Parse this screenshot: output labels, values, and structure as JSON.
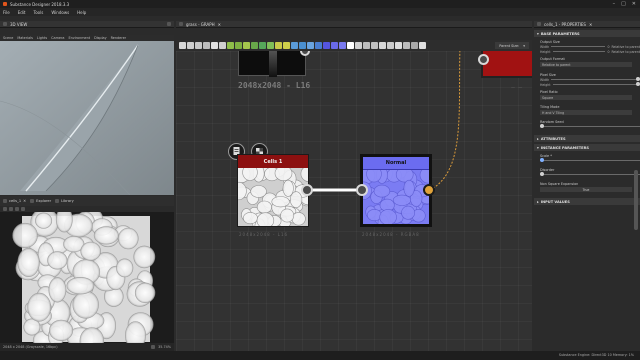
{
  "app": {
    "title": "Substance Designer 2018.3.3",
    "brand_color": "#e0551c"
  },
  "menu": [
    "File",
    "Edit",
    "Tools",
    "Windows",
    "Help"
  ],
  "view3d": {
    "tab": "3D VIEW",
    "menu": [
      "Scene",
      "Materials",
      "Lights",
      "Camera",
      "Environment",
      "Display",
      "Renderer"
    ]
  },
  "view2d": {
    "tabs": [
      {
        "label": "cells_1",
        "icon": "image-icon"
      },
      {
        "label": "Explorer",
        "icon": "folder-icon"
      },
      {
        "label": "Library",
        "icon": "library-icon"
      }
    ],
    "status_left": "2048 x 2048 (Grayscale, 16bpc)",
    "zoom": "35.74%"
  },
  "graph": {
    "tab": "grass - GRAPH",
    "parent_size_label": "Parent Size:",
    "top_node_label": "2048x2048 - L16",
    "cells_node": {
      "title": "Cells 1",
      "footer": "2048x2048 - L16"
    },
    "normal_node": {
      "title": "Normal",
      "footer": "2048x2048 - RGBA8"
    },
    "tool_colors": [
      "#d8d8d8",
      "#cfcfcf",
      "#c8c8c8",
      "#bdbdbd",
      "#e0e0e0",
      "#d0d0d0",
      "#8fbf4a",
      "#7fb042",
      "#a6c74d",
      "#68a84a",
      "#55a85a",
      "#7fbf58",
      "#c9c94a",
      "#cfcf4a",
      "#5a9bd8",
      "#4a8fd0",
      "#6aa4e0",
      "#4a7ed0",
      "#5555e0",
      "#6a6ae8",
      "#7a7af0",
      "#ffffff",
      "#d0d0d0",
      "#bdbdbd",
      "#c0c0c0",
      "#d8d8d8",
      "#cccccc",
      "#dddddd",
      "#bbbbbb",
      "#aaaaaa",
      "#e0e0e0"
    ]
  },
  "properties": {
    "tab": "cells_1 - PROPERTIES",
    "sections": {
      "base": "BASE PARAMETERS",
      "attributes": "ATTRIBUTES",
      "instance": "INSTANCE PARAMETERS",
      "inputs": "INPUT VALUES"
    },
    "output_size": {
      "label": "Output Size",
      "width": "Width",
      "height": "Height",
      "rel_w": "Relative to parent",
      "rel_h": "Relative to parent",
      "val_w": "0",
      "val_h": "0"
    },
    "output_format": {
      "label": "Output Format",
      "value": "Relative to parent"
    },
    "pixel_size": {
      "label": "Pixel Size",
      "width": "Width",
      "height": "Height"
    },
    "pixel_ratio": {
      "label": "Pixel Ratio",
      "value": "Square"
    },
    "tiling_mode": {
      "label": "Tiling Mode",
      "value": "H and V Tiling"
    },
    "random_seed": {
      "label": "Random Seed"
    },
    "scale": {
      "label": "Scale *"
    },
    "disorder": {
      "label": "Disorder"
    },
    "non_square": {
      "label": "Non Square Expansion",
      "value": "True"
    }
  },
  "statusbar": {
    "text": "Substance Engine: Direct3D 10  Memory: 1%"
  }
}
